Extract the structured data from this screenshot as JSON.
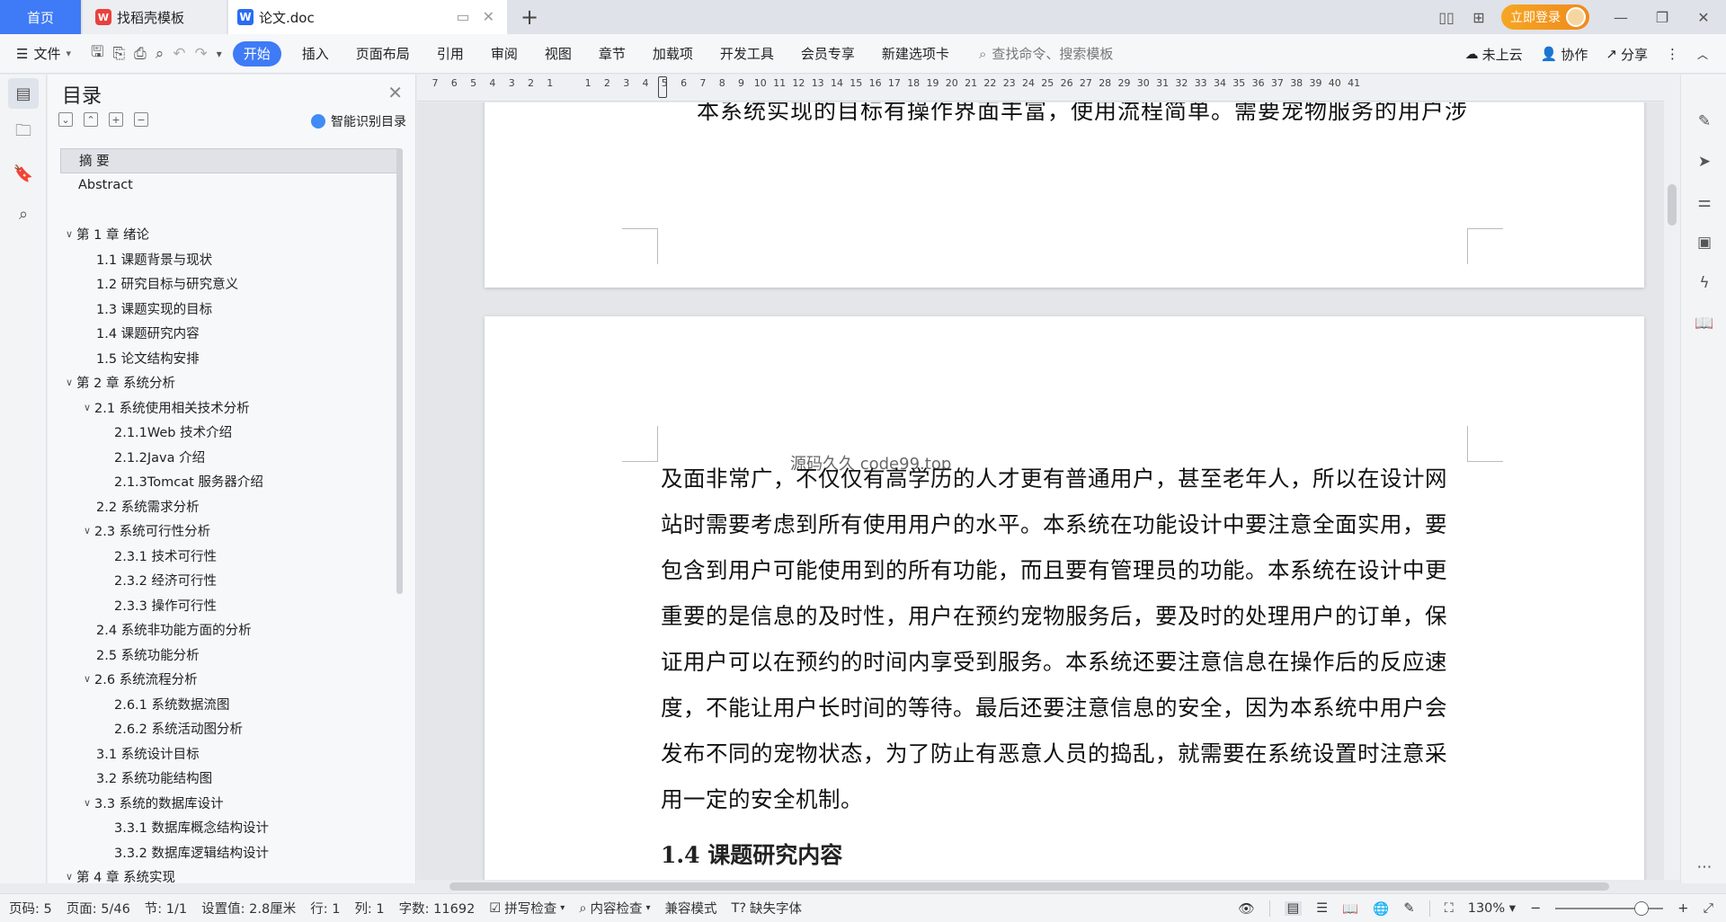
{
  "tabs": {
    "home": "首页",
    "templates": "找稻壳模板",
    "doc": "论文.doc",
    "new_tab": "+"
  },
  "account": {
    "login": "立即登录"
  },
  "ribbon": {
    "file_menu": "文件",
    "tabs": [
      "开始",
      "插入",
      "页面布局",
      "引用",
      "审阅",
      "视图",
      "章节",
      "加载项",
      "开发工具",
      "会员专享",
      "新建选项卡"
    ],
    "search_placeholder": "查找命令、搜索模板",
    "cloud": "未上云",
    "collab": "协作",
    "share": "分享"
  },
  "toc": {
    "title": "目录",
    "smart_label": "智能识别目录",
    "items": [
      {
        "label": "摘  要",
        "level": 1
      },
      {
        "label": "Abstract",
        "level": 1
      },
      {
        "label": "第 1 章  绪论",
        "level": 0
      },
      {
        "label": "1.1 课题背景与现状",
        "level": 2
      },
      {
        "label": "1.2 研究目标与研究意义",
        "level": 2
      },
      {
        "label": "1.3 课题实现的目标",
        "level": 2
      },
      {
        "label": "1.4  课题研究内容",
        "level": 2
      },
      {
        "label": "1.5  论文结构安排",
        "level": 2
      },
      {
        "label": "第 2 章  系统分析",
        "level": 0
      },
      {
        "label": "2.1 系统使用相关技术分析",
        "level": 1.5
      },
      {
        "label": "2.1.1Web 技术介绍",
        "level": 3
      },
      {
        "label": "2.1.2Java 介绍",
        "level": 3
      },
      {
        "label": "2.1.3Tomcat 服务器介绍",
        "level": 3
      },
      {
        "label": "2.2 系统需求分析",
        "level": 2
      },
      {
        "label": "2.3 系统可行性分析",
        "level": 1.5
      },
      {
        "label": "2.3.1 技术可行性",
        "level": 3
      },
      {
        "label": "2.3.2 经济可行性",
        "level": 3
      },
      {
        "label": "2.3.3 操作可行性",
        "level": 3
      },
      {
        "label": "2.4 系统非功能方面的分析",
        "level": 2
      },
      {
        "label": "2.5 系统功能分析",
        "level": 2
      },
      {
        "label": "2.6 系统流程分析",
        "level": 1.5
      },
      {
        "label": "2.6.1 系统数据流图",
        "level": 3
      },
      {
        "label": "2.6.2 系统活动图分析",
        "level": 3
      },
      {
        "label": "3.1 系统设计目标",
        "level": 2
      },
      {
        "label": "3.2 系统功能结构图",
        "level": 2
      },
      {
        "label": "3.3 系统的数据库设计",
        "level": 1.5
      },
      {
        "label": "3.3.1 数据库概念结构设计",
        "level": 3
      },
      {
        "label": "3.3.2 数据库逻辑结构设计",
        "level": 3
      },
      {
        "label": "第 4 章  系统实现",
        "level": 0
      }
    ]
  },
  "ruler": {
    "numbers": [
      "7",
      "6",
      "5",
      "4",
      "3",
      "2",
      "1",
      "1",
      "2",
      "3",
      "4",
      "5",
      "6",
      "7",
      "8",
      "9",
      "10",
      "11",
      "12",
      "13",
      "14",
      "15",
      "16",
      "17",
      "18",
      "19",
      "20",
      "21",
      "22",
      "23",
      "24",
      "25",
      "26",
      "27",
      "28",
      "29",
      "30",
      "31",
      "32",
      "33",
      "34",
      "35",
      "36",
      "37",
      "38",
      "39",
      "40",
      "41"
    ]
  },
  "document": {
    "prev_page_tail": "本系统实现的目标有操作界面丰富，使用流程简单。需要宠物服务的用户涉",
    "watermark": "源码久久 code99.top",
    "paragraph_lines": [
      "及面非常广，不仅仅有高学历的人才更有普通用户，甚至老年人，所以在设计网",
      "站时需要考虑到所有使用用户的水平。本系统在功能设计中要注意全面实用，要",
      "包含到用户可能使用到的所有功能，而且要有管理员的功能。本系统在设计中更",
      "重要的是信息的及时性，用户在预约宠物服务后，要及时的处理用户的订单，保",
      "证用户可以在预约的时间内享受到服务。本系统还要注意信息在操作后的反应速",
      "度，不能让用户长时间的等待。最后还要注意信息的安全，因为本系统中用户会",
      "发布不同的宠物状态，为了防止有恶意人员的捣乱，就需要在系统设置时注意采",
      "用一定的安全机制。"
    ],
    "heading": "1.4  课题研究内容"
  },
  "status": {
    "page_code": "页码: 5",
    "page": "页面: 5/46",
    "section": "节: 1/1",
    "setting": "设置值: 2.8厘米",
    "row": "行: 1",
    "col": "列: 1",
    "word_count": "字数: 11692",
    "spell": "拼写检查",
    "content_check": "内容检查",
    "compat": "兼容模式",
    "missing_font": "缺失字体",
    "zoom": "130%"
  }
}
